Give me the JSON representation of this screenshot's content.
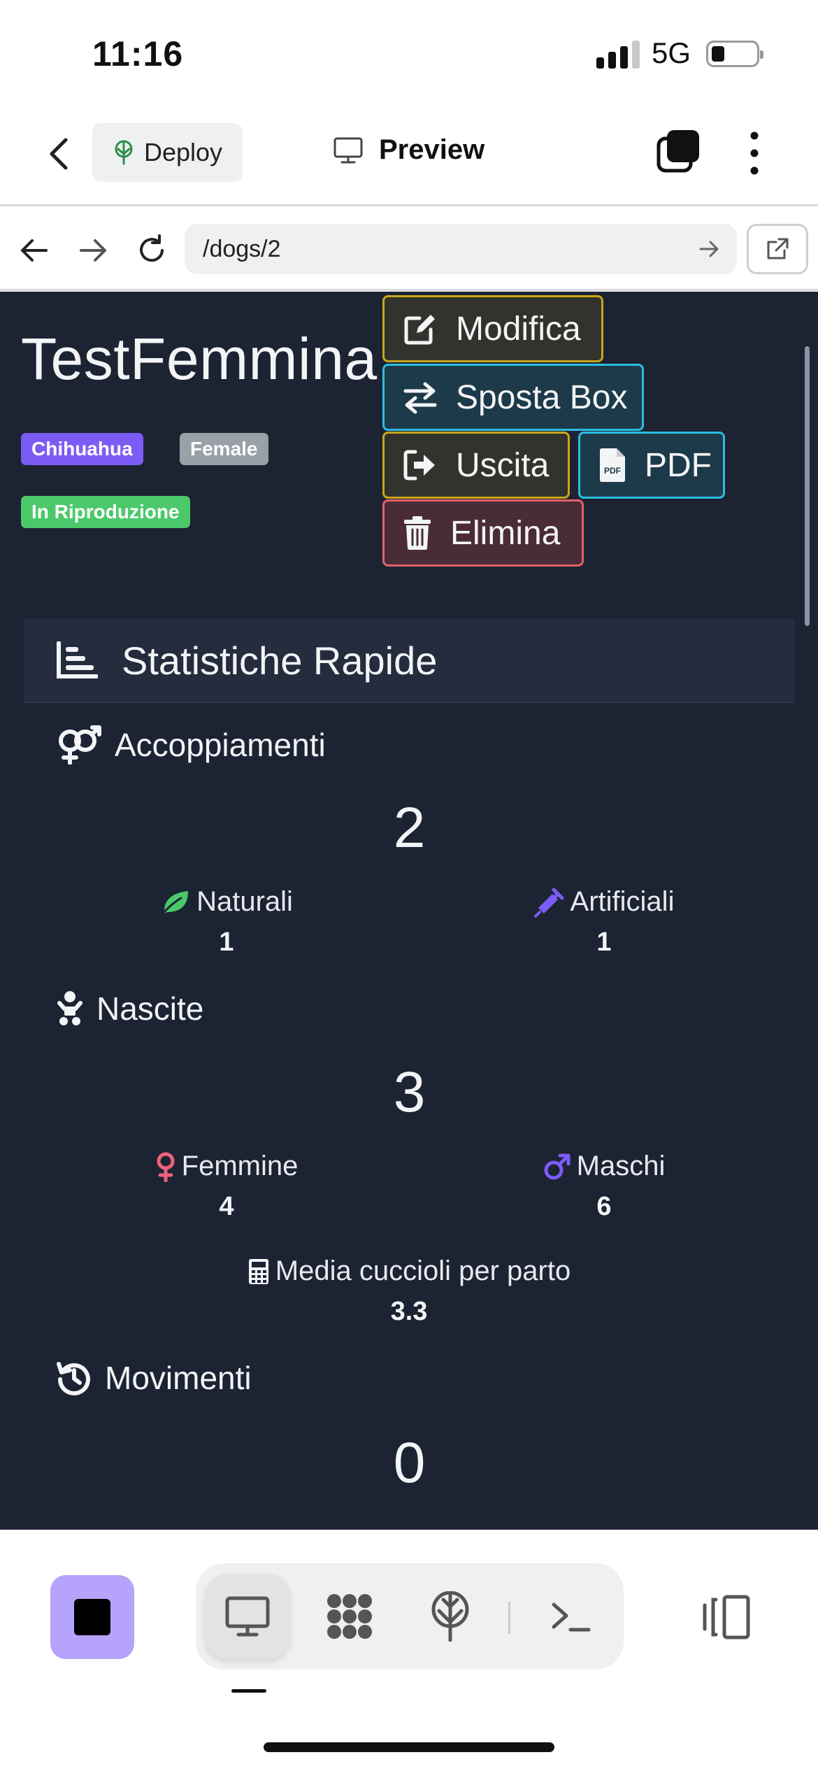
{
  "status_bar": {
    "time": "11:16",
    "network": "5G"
  },
  "header": {
    "deploy_label": "Deploy",
    "preview_label": "Preview"
  },
  "browser": {
    "url": "/dogs/2"
  },
  "dog": {
    "name": "TestFemmina",
    "badges": {
      "breed": "Chihuahua",
      "sex": "Female",
      "status": "In Riproduzione"
    },
    "colors": {
      "breed": "#7c5cf5",
      "sex": "#9aa0a8",
      "status": "#4bc96a"
    }
  },
  "actions": {
    "edit": "Modifica",
    "move_box": "Sposta Box",
    "exit": "Uscita",
    "pdf": "PDF",
    "delete": "Elimina"
  },
  "stats": {
    "title": "Statistiche Rapide",
    "matings": {
      "title": "Accoppiamenti",
      "total": "2",
      "natural_label": "Naturali",
      "natural_value": "1",
      "artificial_label": "Artificiali",
      "artificial_value": "1"
    },
    "births": {
      "title": "Nascite",
      "total": "3",
      "female_label": "Femmine",
      "female_value": "4",
      "male_label": "Maschi",
      "male_value": "6",
      "avg_label": "Media cuccioli per parto",
      "avg_value": "3.3"
    },
    "movements": {
      "title": "Movimenti",
      "total": "0"
    }
  },
  "icons": {
    "status": [
      "signal-icon",
      "battery-icon"
    ],
    "header": [
      "chevron-left-icon",
      "deploy-tree-icon",
      "monitor-icon",
      "stack-icon",
      "kebab-icon"
    ],
    "browser": [
      "arrow-left-icon",
      "arrow-right-icon",
      "reload-icon",
      "arrow-go-icon",
      "external-link-icon"
    ],
    "bottom": [
      "stop-icon",
      "monitor-icon",
      "apps-icon",
      "deploy-tree-icon",
      "terminal-icon",
      "side-panel-icon"
    ]
  },
  "colors_accent": {
    "page_bg": "#1c2333",
    "edit": "#c9a61b",
    "info": "#2bbde0",
    "delete": "#e0626a",
    "female": "#f0627a",
    "male": "#7c5cf5",
    "natural": "#4bc96a"
  }
}
